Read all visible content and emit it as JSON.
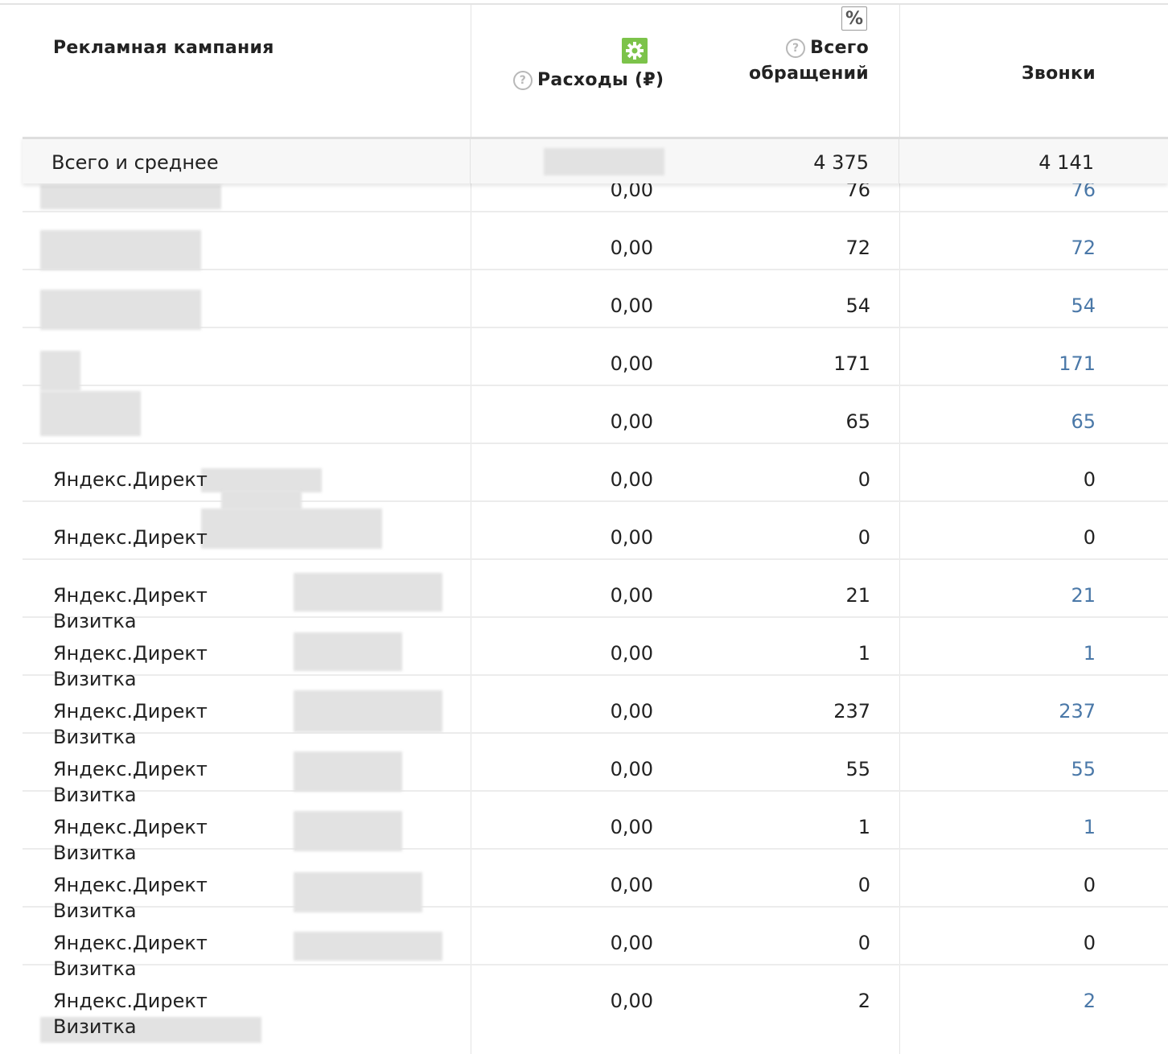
{
  "header": {
    "campaign": "Рекламная кампания",
    "spend": "Расходы (₽)",
    "total_line1": "Всего",
    "total_line2": "обращений",
    "calls": "Звонки",
    "percent_toggle": "%",
    "help_symbol": "?"
  },
  "totals": {
    "label": "Всего и среднее",
    "total": "4 375",
    "calls": "4 141"
  },
  "rows": [
    {
      "name": "",
      "spend": "0,00",
      "total": "76",
      "calls": "76",
      "calls_link": true
    },
    {
      "name": "",
      "spend": "0,00",
      "total": "72",
      "calls": "72",
      "calls_link": true
    },
    {
      "name": "",
      "spend": "0,00",
      "total": "54",
      "calls": "54",
      "calls_link": true
    },
    {
      "name": "",
      "spend": "0,00",
      "total": "171",
      "calls": "171",
      "calls_link": true
    },
    {
      "name": "",
      "spend": "0,00",
      "total": "65",
      "calls": "65",
      "calls_link": true
    },
    {
      "name": "Яндекс.Директ",
      "spend": "0,00",
      "total": "0",
      "calls": "0",
      "calls_link": false
    },
    {
      "name": "Яндекс.Директ",
      "spend": "0,00",
      "total": "0",
      "calls": "0",
      "calls_link": false
    },
    {
      "name": "Яндекс.Директ Визитка",
      "spend": "0,00",
      "total": "21",
      "calls": "21",
      "calls_link": true
    },
    {
      "name": "Яндекс.Директ Визитка",
      "spend": "0,00",
      "total": "1",
      "calls": "1",
      "calls_link": true
    },
    {
      "name": "Яндекс.Директ Визитка",
      "spend": "0,00",
      "total": "237",
      "calls": "237",
      "calls_link": true
    },
    {
      "name": "Яндекс.Директ Визитка",
      "spend": "0,00",
      "total": "55",
      "calls": "55",
      "calls_link": true
    },
    {
      "name": "Яндекс.Директ Визитка",
      "spend": "0,00",
      "total": "1",
      "calls": "1",
      "calls_link": true
    },
    {
      "name": "Яндекс.Директ Визитка",
      "spend": "0,00",
      "total": "0",
      "calls": "0",
      "calls_link": false
    },
    {
      "name": "Яндекс.Директ Визитка",
      "spend": "0,00",
      "total": "0",
      "calls": "0",
      "calls_link": false
    },
    {
      "name": "Яндекс.Директ Визитка",
      "spend": "0,00",
      "total": "2",
      "calls": "2",
      "calls_link": true
    }
  ],
  "colors": {
    "link": "#4a78a8",
    "gear_bg": "#7cc34a",
    "total_bg": "#f7f7f7"
  },
  "icons": {
    "settings": "gear-icon",
    "help": "question-circle-icon",
    "percent": "percent-icon"
  }
}
